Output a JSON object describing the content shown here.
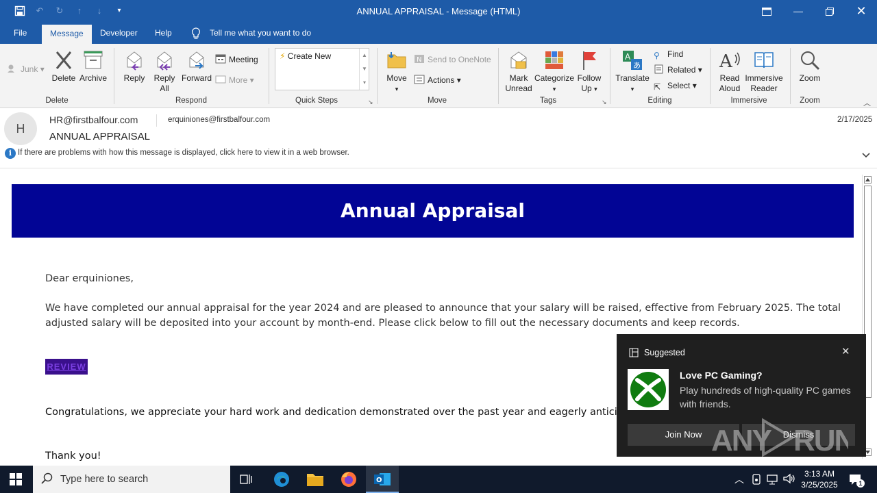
{
  "window": {
    "title": "ANNUAL APPRAISAL  -  Message (HTML)",
    "controls": [
      "restore-ribbon",
      "minimize",
      "maximize",
      "close"
    ]
  },
  "ribbon_tabs": [
    {
      "label": "File"
    },
    {
      "label": "Message",
      "active": true
    },
    {
      "label": "Developer"
    },
    {
      "label": "Help"
    }
  ],
  "tell_me": "Tell me what you want to do",
  "ribbon": {
    "delete_group": {
      "junk": "Junk",
      "delete": "Delete",
      "archive": "Archive",
      "label": "Delete"
    },
    "respond_group": {
      "reply": "Reply",
      "reply_all_line1": "Reply",
      "reply_all_line2": "All",
      "forward": "Forward",
      "meeting": "Meeting",
      "more": "More",
      "label": "Respond"
    },
    "quick_steps": {
      "create_new": "Create New",
      "label": "Quick Steps"
    },
    "move_group": {
      "move": "Move",
      "send_onenote": "Send to OneNote",
      "actions": "Actions",
      "label": "Move"
    },
    "tags_group": {
      "mark_unread_line1": "Mark",
      "mark_unread_line2": "Unread",
      "categorize": "Categorize",
      "follow_up_line1": "Follow",
      "follow_up_line2": "Up",
      "label": "Tags"
    },
    "editing_group": {
      "translate": "Translate",
      "find": "Find",
      "related": "Related",
      "select": "Select",
      "label": "Editing"
    },
    "immersive_group": {
      "read_aloud_line1": "Read",
      "read_aloud_line2": "Aloud",
      "immersive_reader_line1": "Immersive",
      "immersive_reader_line2": "Reader",
      "label": "Immersive"
    },
    "zoom_group": {
      "zoom": "Zoom",
      "label": "Zoom"
    }
  },
  "message": {
    "avatar_letter": "H",
    "from": "HR@firstbalfour.com",
    "to": "erquiniones@firstbalfour.com",
    "subject": "ANNUAL APPRAISAL",
    "date": "2/17/2025",
    "info_bar": "If there are problems with how this message is displayed, click here to view it in a web browser."
  },
  "email_body": {
    "banner": "Annual Appraisal",
    "greeting": "Dear erquiniones,",
    "para1_line1": "We have completed our annual appraisal for the year 2024 and are pleased to announce that your salary will be raised, effective from February 2025.  The total",
    "para1_line2": "adjusted salary will be deposited into your account by month-end. Please click below to fill out the necessary documents and keep records.",
    "review_link": "REVIEW",
    "para2": "Congratulations, we appreciate your hard work and dedication demonstrated over the past year and eagerly anticipate you",
    "closing": "Thank you!"
  },
  "toast": {
    "header": "Suggested",
    "title": "Love PC Gaming?",
    "desc": "Play hundreds of high-quality PC games with friends.",
    "join": "Join Now",
    "dismiss": "Dismiss"
  },
  "watermark": "ANY RUN",
  "taskbar": {
    "search_placeholder": "Type here to search",
    "time": "3:13 AM",
    "date": "3/25/2025",
    "notification_count": "1"
  }
}
